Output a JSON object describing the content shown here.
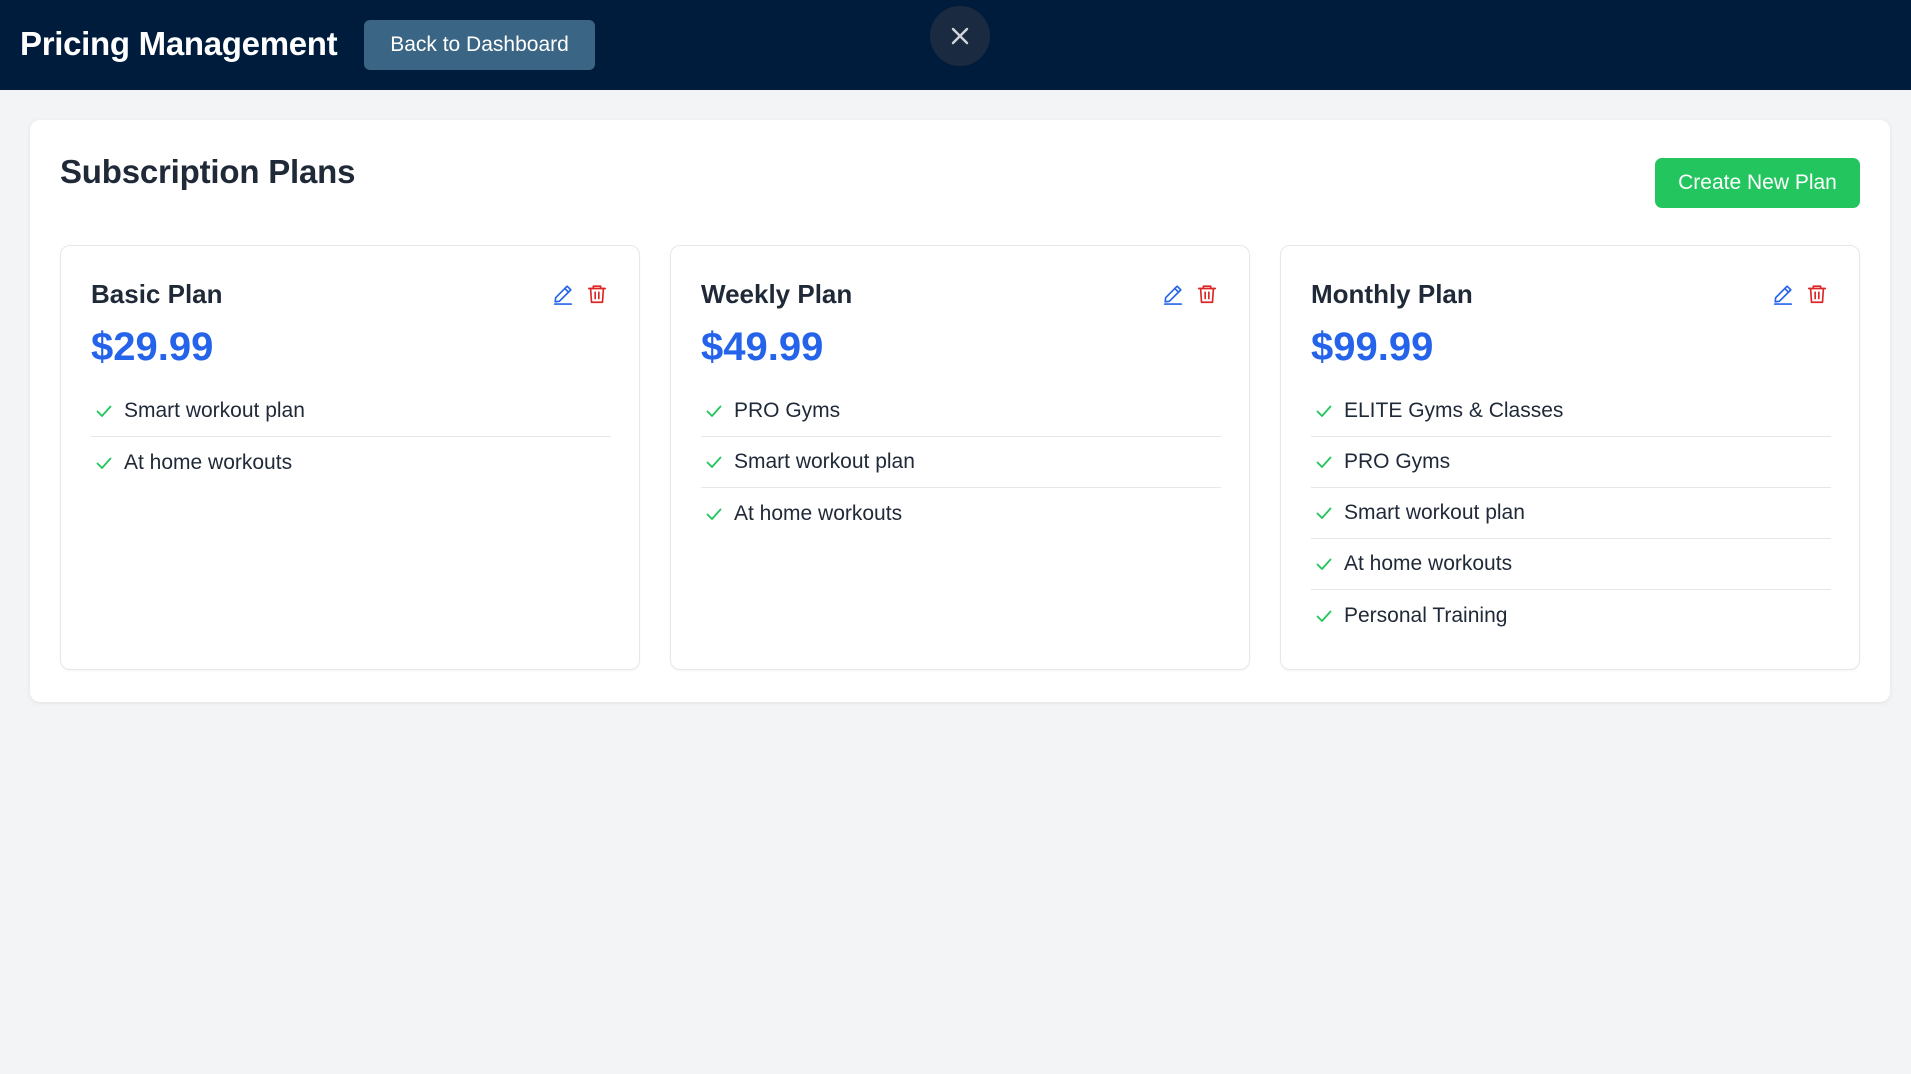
{
  "header": {
    "title": "Pricing Management",
    "back_label": "Back to Dashboard",
    "close_icon": "close-icon",
    "background": "#001c3d"
  },
  "main": {
    "title": "Subscription Plans",
    "create_label": "Create New Plan",
    "plans": [
      {
        "name": "Basic Plan",
        "price": "$29.99",
        "features": [
          "Smart workout plan",
          "At home workouts"
        ]
      },
      {
        "name": "Weekly Plan",
        "price": "$49.99",
        "features": [
          "PRO Gyms",
          "Smart workout plan",
          "At home workouts"
        ]
      },
      {
        "name": "Monthly Plan",
        "price": "$99.99",
        "features": [
          "ELITE Gyms & Classes",
          "PRO Gyms",
          "Smart workout plan",
          "At home workouts",
          "Personal Training"
        ]
      }
    ]
  },
  "colors": {
    "accent_price": "#2563eb",
    "create_button": "#22c55e",
    "back_button": "#3b6584",
    "delete_icon": "#dc2626",
    "check_icon": "#22c55e"
  },
  "icons": {
    "edit": "pencil-edit-icon",
    "delete": "trash-icon",
    "check": "check-icon"
  }
}
